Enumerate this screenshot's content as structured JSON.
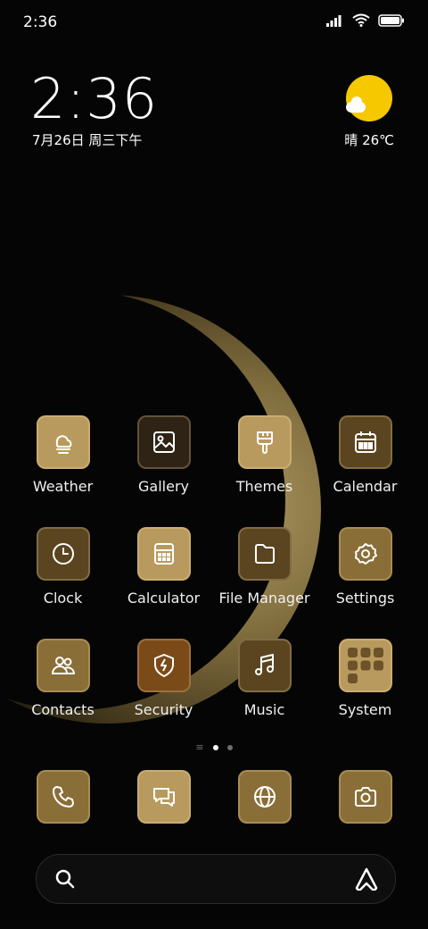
{
  "status": {
    "time": "2:36"
  },
  "clock": {
    "time": "2:36",
    "date": "7月26日 周三下午"
  },
  "weather": {
    "text": "晴 26℃",
    "icon": "sun-cloud-icon"
  },
  "apps": [
    {
      "label": "Weather",
      "icon": "weather-fog-icon"
    },
    {
      "label": "Gallery",
      "icon": "image-icon"
    },
    {
      "label": "Themes",
      "icon": "paintbrush-icon"
    },
    {
      "label": "Calendar",
      "icon": "calendar-icon"
    },
    {
      "label": "Clock",
      "icon": "clock-icon"
    },
    {
      "label": "Calculator",
      "icon": "calculator-icon"
    },
    {
      "label": "File Manager",
      "icon": "folder-icon"
    },
    {
      "label": "Settings",
      "icon": "gear-icon"
    },
    {
      "label": "Contacts",
      "icon": "people-icon"
    },
    {
      "label": "Security",
      "icon": "shield-bolt-icon"
    },
    {
      "label": "Music",
      "icon": "music-note-icon"
    },
    {
      "label": "System",
      "icon": "folder-grid-icon"
    }
  ],
  "dock": [
    {
      "icon": "phone-icon"
    },
    {
      "icon": "messages-icon"
    },
    {
      "icon": "browser-globe-icon"
    },
    {
      "icon": "camera-icon"
    }
  ],
  "colors": {
    "icon_light": "#b99a5e",
    "icon_mid": "#8a6e38",
    "icon_dark": "#5a4520",
    "sun": "#f5c800"
  }
}
